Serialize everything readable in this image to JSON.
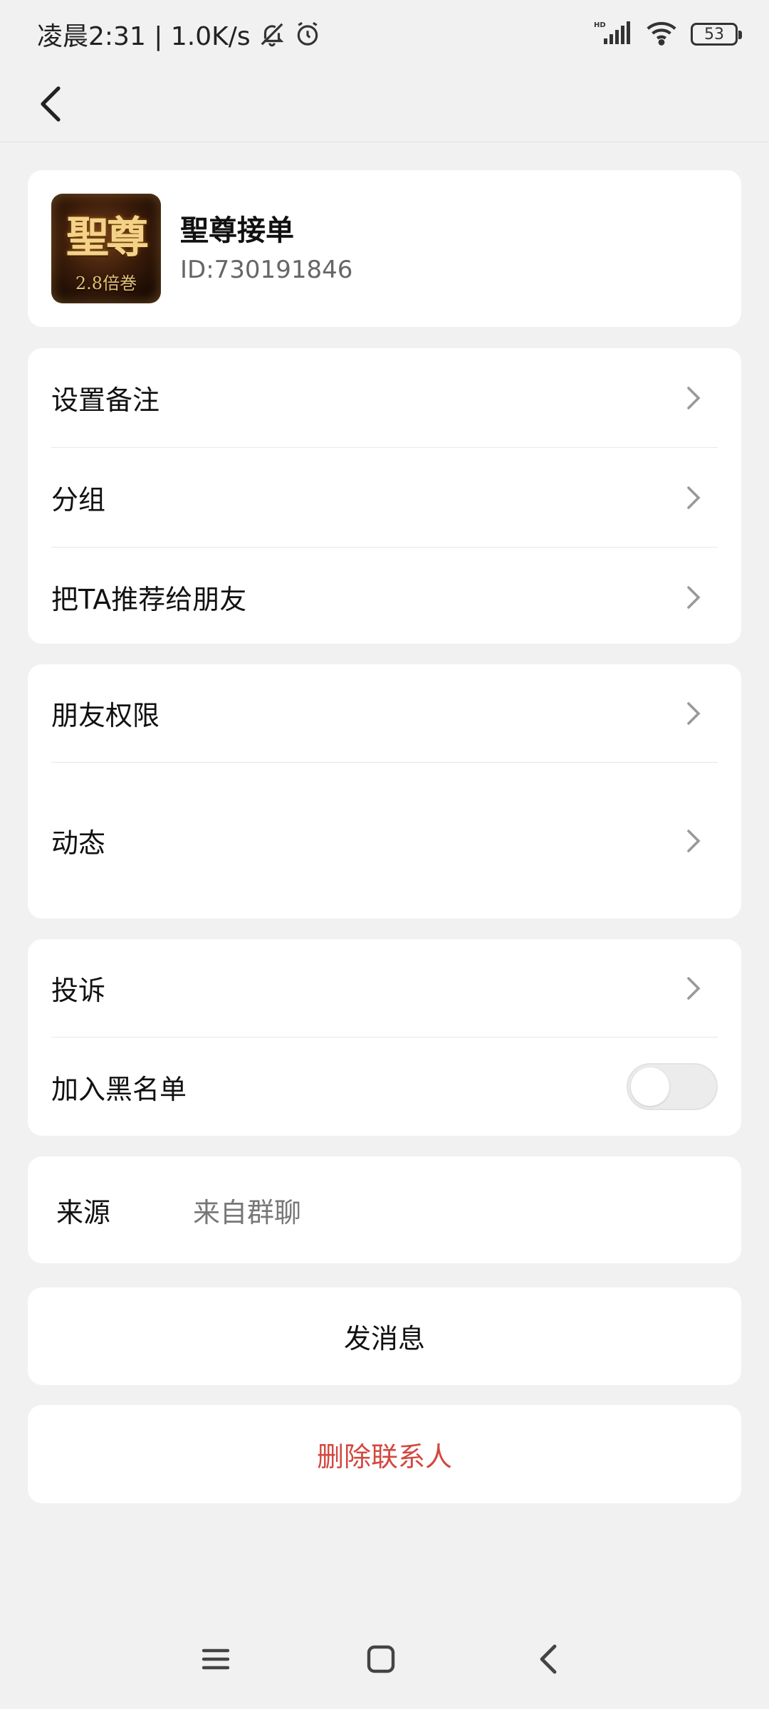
{
  "status_bar": {
    "time_and_speed": "凌晨2:31 | 1.0K/s",
    "battery": "53",
    "signal_label": "HD"
  },
  "profile": {
    "name": "聖尊接单",
    "id": "ID:730191846",
    "avatar_text": "聖尊",
    "avatar_subtext": "2.8倍巻"
  },
  "group1": {
    "items": [
      {
        "label": "设置备注"
      },
      {
        "label": "分组"
      },
      {
        "label": "把TA推荐给朋友"
      }
    ]
  },
  "group2": {
    "items": [
      {
        "label": "朋友权限"
      },
      {
        "label": "动态"
      }
    ]
  },
  "group3": {
    "complaint_label": "投诉",
    "blacklist_label": "加入黑名单",
    "blacklist_enabled": false
  },
  "source": {
    "label": "来源",
    "value": "来自群聊"
  },
  "actions": {
    "send_message": "发消息",
    "delete_contact": "删除联系人"
  },
  "colors": {
    "danger": "#d2483f",
    "background": "#f1f1f1"
  },
  "icons": {
    "back": "back-arrow-icon",
    "chevron": "chevron-right-icon",
    "mute": "bell-off-icon",
    "alarm": "alarm-icon",
    "nav_menu": "menu-icon",
    "nav_home": "home-icon",
    "nav_back": "back-icon"
  }
}
